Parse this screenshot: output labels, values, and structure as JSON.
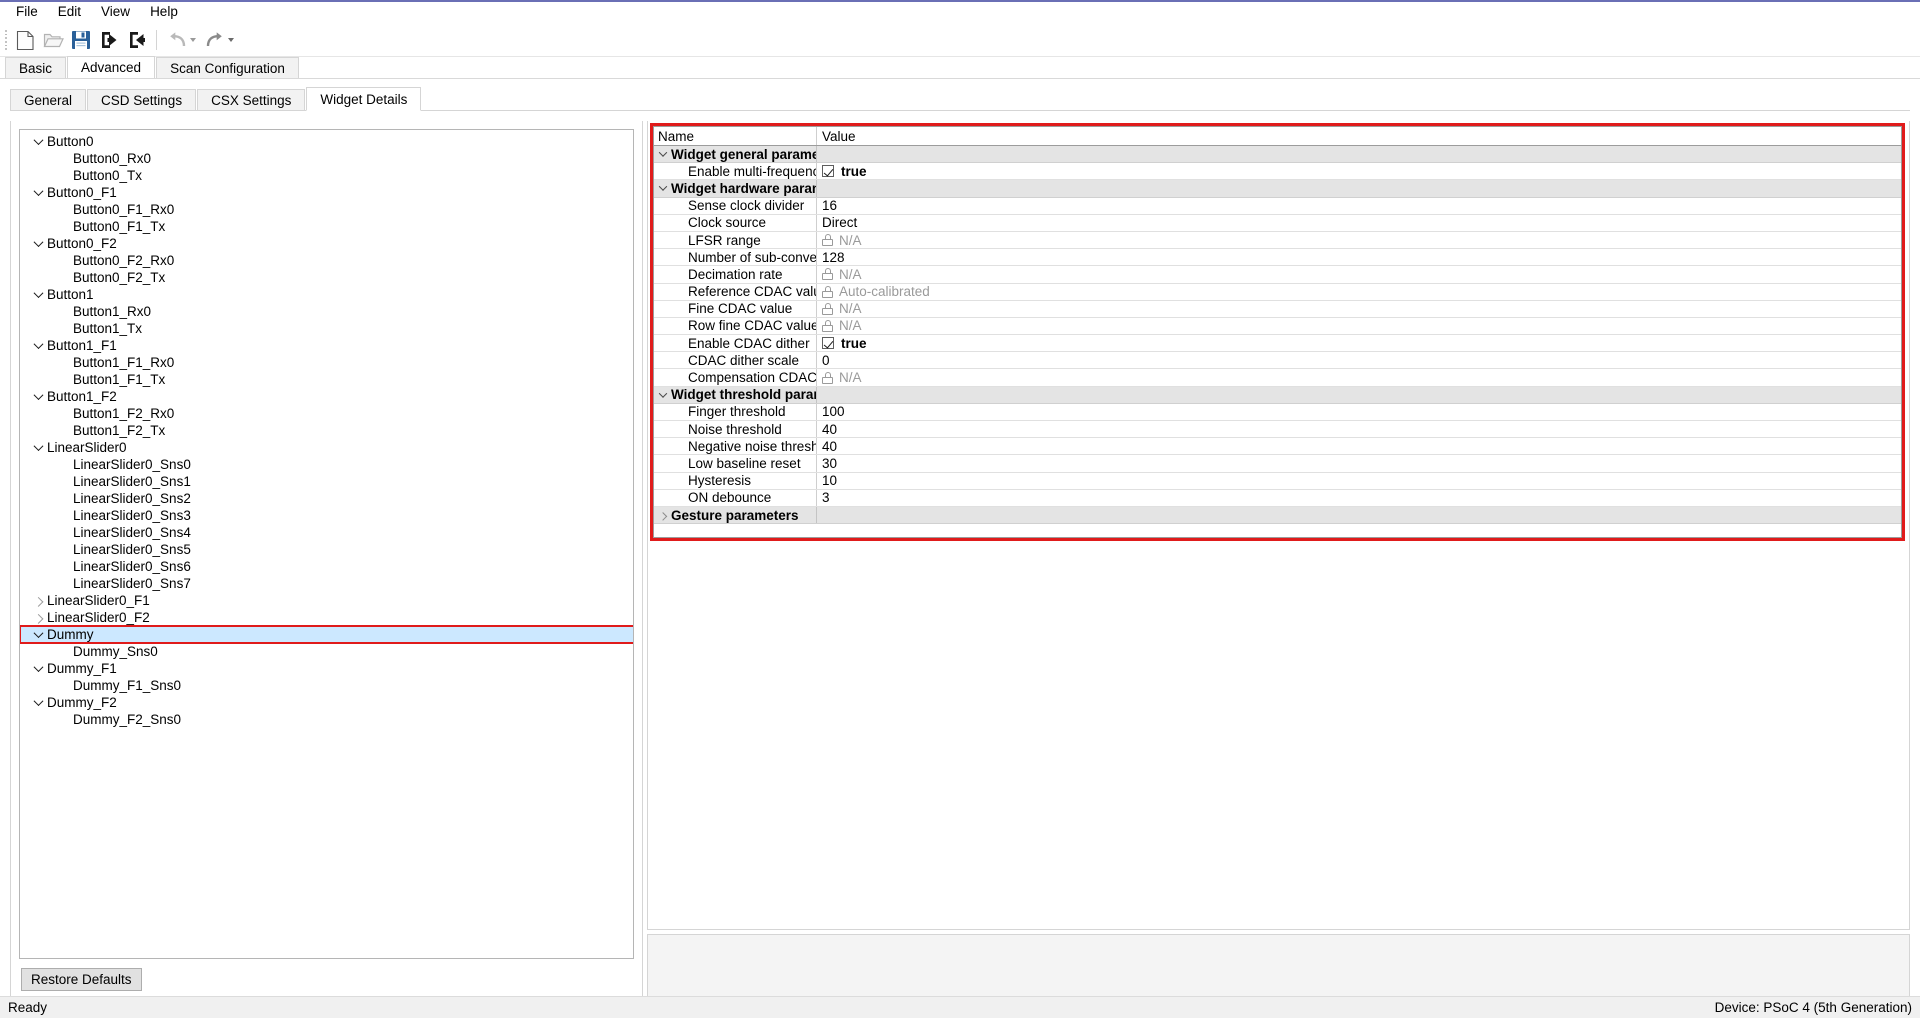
{
  "menubar": {
    "items": [
      {
        "label": "File",
        "name": "menu-file"
      },
      {
        "label": "Edit",
        "name": "menu-edit"
      },
      {
        "label": "View",
        "name": "menu-view"
      },
      {
        "label": "Help",
        "name": "menu-help"
      }
    ]
  },
  "toolbar": {
    "buttons": [
      {
        "name": "new-file-icon",
        "title": "New"
      },
      {
        "name": "open-folder-icon",
        "title": "Open"
      },
      {
        "name": "save-icon",
        "title": "Save"
      },
      {
        "name": "import-icon",
        "title": "Import"
      },
      {
        "name": "export-icon",
        "title": "Export"
      },
      {
        "name": "undo-icon",
        "title": "Undo"
      },
      {
        "name": "redo-icon",
        "title": "Redo"
      }
    ]
  },
  "outer_tabs": [
    {
      "label": "Basic",
      "active": false
    },
    {
      "label": "Advanced",
      "active": true
    },
    {
      "label": "Scan Configuration",
      "active": false
    }
  ],
  "inner_tabs": [
    {
      "label": "General",
      "active": false
    },
    {
      "label": "CSD Settings",
      "active": false
    },
    {
      "label": "CSX Settings",
      "active": false
    },
    {
      "label": "Widget Details",
      "active": true
    }
  ],
  "tree": {
    "items": [
      {
        "label": "Button0",
        "level": 0,
        "twist": "down",
        "selected": false
      },
      {
        "label": "Button0_Rx0",
        "level": 1,
        "twist": "none",
        "selected": false
      },
      {
        "label": "Button0_Tx",
        "level": 1,
        "twist": "none",
        "selected": false
      },
      {
        "label": "Button0_F1",
        "level": 0,
        "twist": "down",
        "selected": false
      },
      {
        "label": "Button0_F1_Rx0",
        "level": 1,
        "twist": "none",
        "selected": false
      },
      {
        "label": "Button0_F1_Tx",
        "level": 1,
        "twist": "none",
        "selected": false
      },
      {
        "label": "Button0_F2",
        "level": 0,
        "twist": "down",
        "selected": false
      },
      {
        "label": "Button0_F2_Rx0",
        "level": 1,
        "twist": "none",
        "selected": false
      },
      {
        "label": "Button0_F2_Tx",
        "level": 1,
        "twist": "none",
        "selected": false
      },
      {
        "label": "Button1",
        "level": 0,
        "twist": "down",
        "selected": false
      },
      {
        "label": "Button1_Rx0",
        "level": 1,
        "twist": "none",
        "selected": false
      },
      {
        "label": "Button1_Tx",
        "level": 1,
        "twist": "none",
        "selected": false
      },
      {
        "label": "Button1_F1",
        "level": 0,
        "twist": "down",
        "selected": false
      },
      {
        "label": "Button1_F1_Rx0",
        "level": 1,
        "twist": "none",
        "selected": false
      },
      {
        "label": "Button1_F1_Tx",
        "level": 1,
        "twist": "none",
        "selected": false
      },
      {
        "label": "Button1_F2",
        "level": 0,
        "twist": "down",
        "selected": false
      },
      {
        "label": "Button1_F2_Rx0",
        "level": 1,
        "twist": "none",
        "selected": false
      },
      {
        "label": "Button1_F2_Tx",
        "level": 1,
        "twist": "none",
        "selected": false
      },
      {
        "label": "LinearSlider0",
        "level": 0,
        "twist": "down",
        "selected": false
      },
      {
        "label": "LinearSlider0_Sns0",
        "level": 1,
        "twist": "none",
        "selected": false
      },
      {
        "label": "LinearSlider0_Sns1",
        "level": 1,
        "twist": "none",
        "selected": false
      },
      {
        "label": "LinearSlider0_Sns2",
        "level": 1,
        "twist": "none",
        "selected": false
      },
      {
        "label": "LinearSlider0_Sns3",
        "level": 1,
        "twist": "none",
        "selected": false
      },
      {
        "label": "LinearSlider0_Sns4",
        "level": 1,
        "twist": "none",
        "selected": false
      },
      {
        "label": "LinearSlider0_Sns5",
        "level": 1,
        "twist": "none",
        "selected": false
      },
      {
        "label": "LinearSlider0_Sns6",
        "level": 1,
        "twist": "none",
        "selected": false
      },
      {
        "label": "LinearSlider0_Sns7",
        "level": 1,
        "twist": "none",
        "selected": false
      },
      {
        "label": "LinearSlider0_F1",
        "level": 0,
        "twist": "right",
        "selected": false
      },
      {
        "label": "LinearSlider0_F2",
        "level": 0,
        "twist": "right",
        "selected": false
      },
      {
        "label": "Dummy",
        "level": 0,
        "twist": "down",
        "selected": true
      },
      {
        "label": "Dummy_Sns0",
        "level": 1,
        "twist": "none",
        "selected": false
      },
      {
        "label": "Dummy_F1",
        "level": 0,
        "twist": "down",
        "selected": false
      },
      {
        "label": "Dummy_F1_Sns0",
        "level": 1,
        "twist": "none",
        "selected": false
      },
      {
        "label": "Dummy_F2",
        "level": 0,
        "twist": "down",
        "selected": false
      },
      {
        "label": "Dummy_F2_Sns0",
        "level": 1,
        "twist": "none",
        "selected": false
      }
    ]
  },
  "restore_defaults_label": "Restore Defaults",
  "grid": {
    "headers": {
      "name": "Name",
      "value": "Value"
    },
    "rows": [
      {
        "kind": "group",
        "twist": "down",
        "name": "Widget general parameters",
        "value": ""
      },
      {
        "kind": "param",
        "name": "Enable multi-frequency scan",
        "value": "true",
        "value_type": "checkbox",
        "checked": true
      },
      {
        "kind": "group",
        "twist": "down",
        "name": "Widget hardware parameters",
        "value": ""
      },
      {
        "kind": "param",
        "name": "Sense clock divider",
        "value": "16",
        "value_type": "text"
      },
      {
        "kind": "param",
        "name": "Clock source",
        "value": "Direct",
        "value_type": "text"
      },
      {
        "kind": "param",
        "name": "LFSR range",
        "value": "N/A",
        "value_type": "locked"
      },
      {
        "kind": "param",
        "name": "Number of sub-conversions",
        "value": "128",
        "value_type": "text"
      },
      {
        "kind": "param",
        "name": "Decimation rate",
        "value": "N/A",
        "value_type": "locked"
      },
      {
        "kind": "param",
        "name": "Reference CDAC value",
        "value": "Auto-calibrated",
        "value_type": "locked"
      },
      {
        "kind": "param",
        "name": "Fine CDAC value",
        "value": "N/A",
        "value_type": "locked"
      },
      {
        "kind": "param",
        "name": "Row fine CDAC value",
        "value": "N/A",
        "value_type": "locked"
      },
      {
        "kind": "param",
        "name": "Enable CDAC dither",
        "value": "true",
        "value_type": "checkbox",
        "checked": true
      },
      {
        "kind": "param",
        "name": "CDAC dither scale",
        "value": "0",
        "value_type": "text"
      },
      {
        "kind": "param",
        "name": "Compensation CDAC divider",
        "value": "N/A",
        "value_type": "locked"
      },
      {
        "kind": "group",
        "twist": "down",
        "name": "Widget threshold parameters",
        "value": ""
      },
      {
        "kind": "param",
        "name": "Finger threshold",
        "value": "100",
        "value_type": "text"
      },
      {
        "kind": "param",
        "name": "Noise threshold",
        "value": "40",
        "value_type": "text"
      },
      {
        "kind": "param",
        "name": "Negative noise threshold",
        "value": "40",
        "value_type": "text"
      },
      {
        "kind": "param",
        "name": "Low baseline reset",
        "value": "30",
        "value_type": "text"
      },
      {
        "kind": "param",
        "name": "Hysteresis",
        "value": "10",
        "value_type": "text"
      },
      {
        "kind": "param",
        "name": "ON debounce",
        "value": "3",
        "value_type": "text"
      },
      {
        "kind": "group",
        "twist": "right",
        "name": "Gesture parameters",
        "value": ""
      }
    ]
  },
  "statusbar": {
    "left": "Ready",
    "right": "Device: PSoC 4 (5th Generation)"
  },
  "colors": {
    "highlight_red": "#e01b1b",
    "selection_blue": "#cce8ff",
    "group_gray": "#e4e4e4",
    "accent_top": "#6a6fb5"
  }
}
